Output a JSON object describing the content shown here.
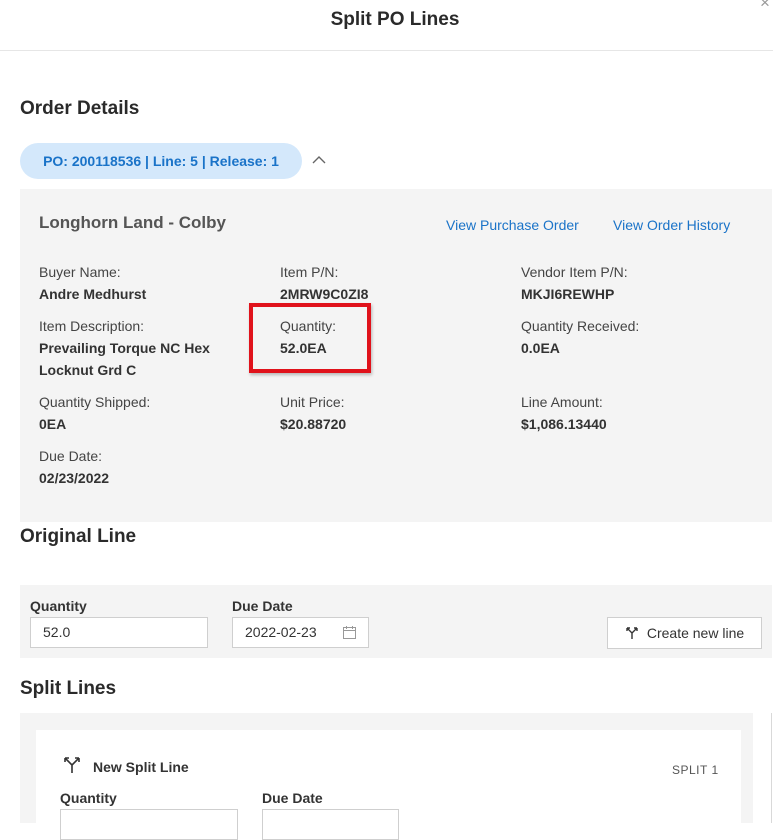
{
  "header": {
    "title": "Split PO Lines",
    "close": "×"
  },
  "order_details": {
    "title": "Order Details",
    "po_pill": "PO: 200118536 | Line: 5 | Release: 1",
    "card": {
      "title": "Longhorn Land - Colby",
      "view_po_link": "View Purchase Order",
      "view_history_link": "View Order History",
      "fields": {
        "buyer_name": {
          "label": "Buyer Name:",
          "value": "Andre Medhurst"
        },
        "item_pn": {
          "label": "Item P/N:",
          "value": "2MRW9C0ZI8"
        },
        "vendor_item_pn": {
          "label": "Vendor Item P/N:",
          "value": "MKJI6REWHP"
        },
        "item_description": {
          "label": "Item Description:",
          "value_line1": "Prevailing Torque NC Hex",
          "value_line2": "Locknut Grd C"
        },
        "quantity": {
          "label": "Quantity:",
          "value": "52.0EA"
        },
        "quantity_received": {
          "label": "Quantity Received:",
          "value": "0.0EA"
        },
        "quantity_shipped": {
          "label": "Quantity Shipped:",
          "value": "0EA"
        },
        "unit_price": {
          "label": "Unit Price:",
          "value": "$20.88720"
        },
        "line_amount": {
          "label": "Line Amount:",
          "value": "$1,086.13440"
        },
        "due_date": {
          "label": "Due Date:",
          "value": "02/23/2022"
        }
      }
    }
  },
  "original_line": {
    "title": "Original Line",
    "quantity_label": "Quantity",
    "quantity_value": "52.0",
    "due_date_label": "Due Date",
    "due_date_value": "2022-02-23",
    "create_button": "Create new line"
  },
  "split_lines": {
    "title": "Split Lines",
    "card": {
      "title": "New Split Line",
      "badge": "SPLIT 1",
      "quantity_label": "Quantity",
      "due_date_label": "Due Date"
    }
  },
  "colors": {
    "accent": "#1a73c8",
    "pill_bg": "#d4e8fb",
    "highlight": "#e0121b",
    "panel_bg": "#f4f4f4"
  }
}
